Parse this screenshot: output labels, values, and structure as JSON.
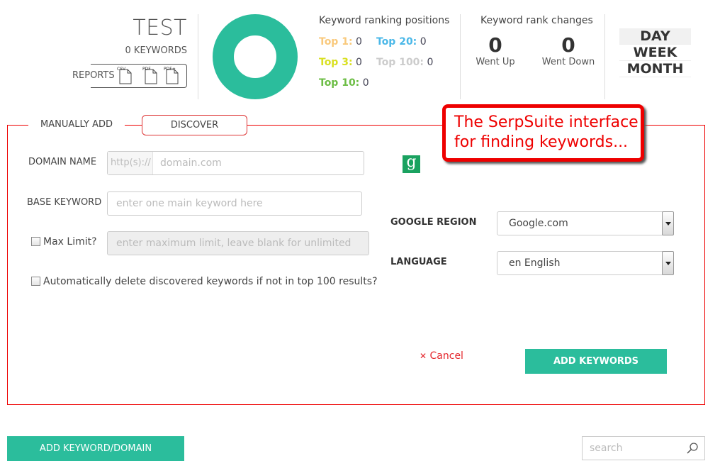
{
  "project": {
    "title": "TEST",
    "keyword_count": "0 KEYWORDS",
    "reports_label": "REPORTS",
    "report_formats": [
      "CSV",
      "PDF",
      "PDF+"
    ]
  },
  "ranking_chart": {
    "color": "#2bbd9c"
  },
  "ranking_positions": {
    "title": "Keyword ranking positions",
    "items": [
      {
        "label": "Top 1:",
        "value": "0",
        "color": "#f9c97c"
      },
      {
        "label": "Top 20:",
        "value": "0",
        "color": "#4bb8e8"
      },
      {
        "label": "Top 3:",
        "value": "0",
        "color": "#d9e021"
      },
      {
        "label": "Top 100:",
        "value": "0",
        "color": "#cccccc"
      },
      {
        "label": "Top 10:",
        "value": "0",
        "color": "#6cbd45"
      }
    ]
  },
  "rank_changes": {
    "title": "Keyword rank changes",
    "went_up": {
      "value": "0",
      "label": "Went Up"
    },
    "went_down": {
      "value": "0",
      "label": "Went Down"
    }
  },
  "period": {
    "options": [
      "DAY",
      "WEEK",
      "MONTH"
    ],
    "selected": "DAY"
  },
  "tabs": {
    "manual": "MANUALLY ADD",
    "discover": "DISCOVER"
  },
  "form": {
    "domain_label": "DOMAIN NAME",
    "domain_prefix": "http(s)://",
    "domain_placeholder": "domain.com",
    "base_keyword_label": "BASE KEYWORD",
    "base_keyword_placeholder": "enter one main keyword here",
    "max_limit_label": "Max Limit?",
    "max_limit_placeholder": "enter maximum limit, leave blank for unlimited",
    "auto_delete_label": "Automatically delete discovered keywords if not in top 100 results?",
    "google_region_label": "GOOGLE REGION",
    "google_region_value": "Google.com",
    "language_label": "LANGUAGE",
    "language_value": "en English",
    "cancel_label": "Cancel",
    "cancel_icon": "✕",
    "add_keywords_label": "ADD KEYWORDS"
  },
  "google_icon_glyph": "g",
  "footer": {
    "add_domain_label": "ADD KEYWORD/DOMAIN",
    "search_placeholder": "search"
  },
  "callout": {
    "line1": "The SerpSuite interface",
    "line2": "for finding keywords..."
  }
}
